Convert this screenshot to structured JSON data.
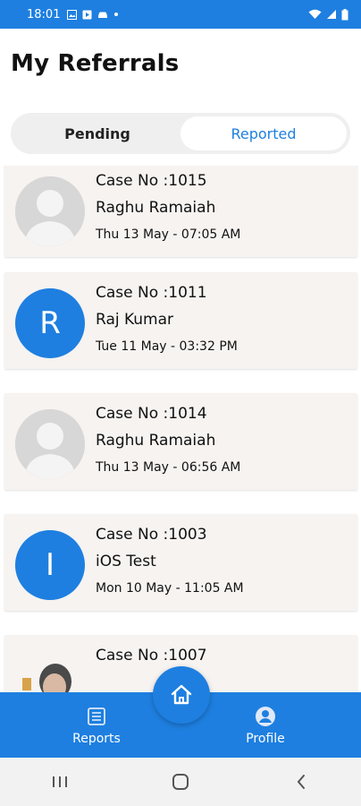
{
  "status_bar": {
    "time": "18:01"
  },
  "header": {
    "title": "My Referrals"
  },
  "tabs": [
    {
      "label": "Pending",
      "active": false
    },
    {
      "label": "Reported",
      "active": true
    }
  ],
  "referrals": [
    {
      "case_no": "Case No :1015",
      "name": "Raghu Ramaiah",
      "date": "Thu 13 May - 07:05 AM",
      "avatar": "placeholder"
    },
    {
      "case_no": "Case No :1011",
      "name": "Raj Kumar",
      "date": "Tue 11 May - 03:32 PM",
      "avatar": "letter",
      "avatar_letter": "R"
    },
    {
      "case_no": "Case No :1014",
      "name": "Raghu Ramaiah",
      "date": "Thu 13 May - 06:56 AM",
      "avatar": "placeholder"
    },
    {
      "case_no": "Case No :1003",
      "name": "iOS  Test",
      "date": "Mon 10 May - 11:05 AM",
      "avatar": "letter",
      "avatar_letter": "I"
    },
    {
      "case_no": "Case No :1007",
      "name": "",
      "date": "",
      "avatar": "photo"
    }
  ],
  "bottom_nav": {
    "reports_label": "Reports",
    "profile_label": "Profile",
    "home_icon": "home-icon"
  },
  "colors": {
    "accent": "#1e7fe0",
    "card_bg": "#f6f3f1",
    "segment_bg": "#efefef"
  }
}
